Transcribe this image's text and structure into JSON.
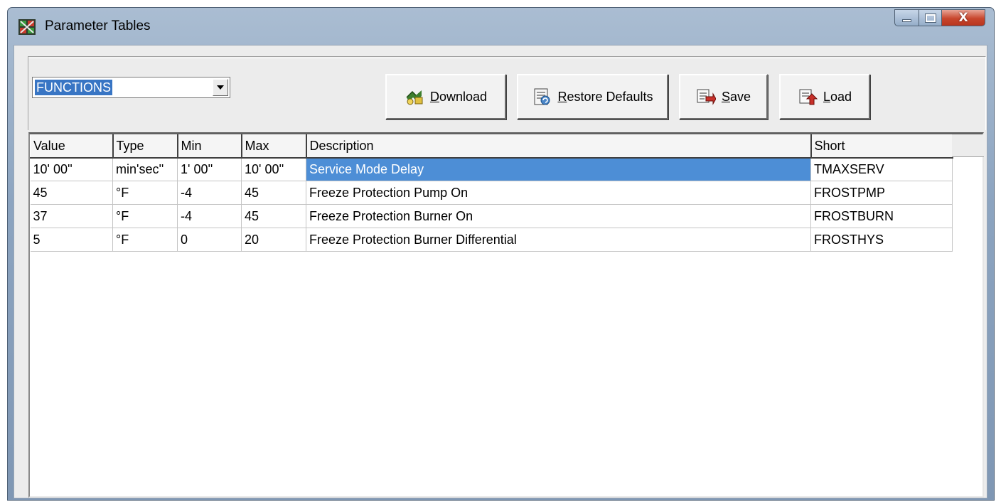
{
  "window": {
    "title": "Parameter Tables",
    "close_glyph": "X"
  },
  "toolbar": {
    "table_select": {
      "value": "FUNCTIONS"
    },
    "download": {
      "accel": "D",
      "rest": "ownload"
    },
    "restore": {
      "accel": "R",
      "rest": "estore Defaults"
    },
    "save": {
      "accel": "S",
      "rest": "ave"
    },
    "load": {
      "accel": "L",
      "rest": "oad"
    }
  },
  "grid": {
    "columns": [
      "Value",
      "Type",
      "Min",
      "Max",
      "Description",
      "Short"
    ],
    "rows": [
      [
        "10' 00''",
        "min'sec''",
        "1' 00''",
        "10' 00''",
        "Service Mode Delay",
        "TMAXSERV"
      ],
      [
        "45",
        "°F",
        "-4",
        "45",
        "Freeze Protection Pump On",
        "FROSTPMP"
      ],
      [
        "37",
        "°F",
        "-4",
        "45",
        "Freeze Protection Burner On",
        "FROSTBURN"
      ],
      [
        "5",
        "°F",
        "0",
        "20",
        "Freeze Protection Burner Differential",
        "FROSTHYS"
      ]
    ],
    "selected_row": 0
  },
  "icons": {
    "app": "app-grid-icon",
    "download": "download-icon",
    "restore": "restore-defaults-icon",
    "save": "save-icon",
    "load": "load-icon"
  },
  "colors": {
    "selection": "#4d8ed6",
    "combo_highlight": "#3875c4",
    "close_button": "#c8462d"
  }
}
